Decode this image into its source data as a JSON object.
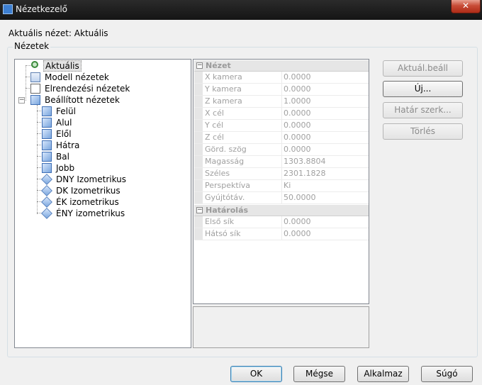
{
  "window": {
    "title": "Nézetkezelő",
    "close_label": "✕"
  },
  "current_view_label": "Aktuális nézet: Aktuális",
  "group_label": "Nézetek",
  "tree": {
    "items": [
      {
        "label": "Aktuális",
        "icon": "magnifier-icon"
      },
      {
        "label": "Modell nézetek",
        "icon": "model-views-icon"
      },
      {
        "label": "Elrendezési nézetek",
        "icon": "layout-views-icon"
      },
      {
        "label": "Beállított nézetek",
        "icon": "cube-icon",
        "expander": "−"
      },
      {
        "label": "Felül",
        "icon": "cube-icon"
      },
      {
        "label": "Alul",
        "icon": "cube-icon"
      },
      {
        "label": "Elől",
        "icon": "cube-icon"
      },
      {
        "label": "Hátra",
        "icon": "cube-icon"
      },
      {
        "label": "Bal",
        "icon": "cube-icon"
      },
      {
        "label": "Jobb",
        "icon": "cube-icon"
      },
      {
        "label": "DNY Izometrikus",
        "icon": "iso-diamond-icon"
      },
      {
        "label": "DK Izometrikus",
        "icon": "iso-diamond-icon"
      },
      {
        "label": "ÉK izometrikus",
        "icon": "iso-diamond-icon"
      },
      {
        "label": "ÉNY izometrikus",
        "icon": "iso-diamond-icon"
      }
    ]
  },
  "properties": {
    "view_section": {
      "label": "Nézet",
      "toggle": "−"
    },
    "view_rows": [
      {
        "name": "X kamera",
        "value": "0.0000"
      },
      {
        "name": "Y kamera",
        "value": "0.0000"
      },
      {
        "name": "Z kamera",
        "value": "1.0000"
      },
      {
        "name": "X cél",
        "value": "0.0000"
      },
      {
        "name": "Y cél",
        "value": "0.0000"
      },
      {
        "name": "Z cél",
        "value": "0.0000"
      },
      {
        "name": "Görd. szög",
        "value": "0.0000"
      },
      {
        "name": "Magasság",
        "value": "1303.8804"
      },
      {
        "name": "Széles",
        "value": "2301.1828"
      },
      {
        "name": "Perspektíva",
        "value": "Ki"
      },
      {
        "name": "Gyújtótáv.",
        "value": "50.0000"
      }
    ],
    "bounds_section": {
      "label": "Határolás",
      "toggle": "−"
    },
    "bounds_rows": [
      {
        "name": "Első sík",
        "value": "0.0000"
      },
      {
        "name": "Hátsó sík",
        "value": "0.0000"
      }
    ]
  },
  "side_buttons": {
    "set_current": "Aktuál.beáll",
    "new": "Új...",
    "edit_bounds": "Határ szerk...",
    "delete": "Törlés"
  },
  "bottom_buttons": {
    "ok": "OK",
    "cancel": "Mégse",
    "apply": "Alkalmaz",
    "help": "Súgó"
  },
  "colors": {
    "titlebar": "#1c1c1c",
    "close_button": "#c74b36",
    "dialog_bg": "#f0f0f0"
  }
}
